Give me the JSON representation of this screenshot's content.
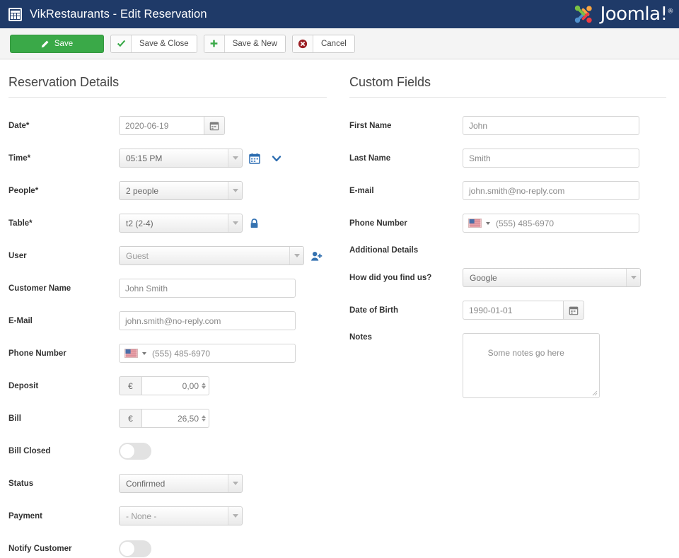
{
  "header": {
    "icon": "calendar-icon",
    "title": "VikRestaurants - Edit Reservation",
    "brand": "Joomla!",
    "brand_sup": "®",
    "bg_color": "#1f3a68"
  },
  "toolbar": {
    "save_label": "Save",
    "save_close_label": "Save & Close",
    "save_new_label": "Save & New",
    "cancel_label": "Cancel",
    "save_color": "#3aa948",
    "cancel_icon_color": "#9b1f24"
  },
  "left": {
    "section_title": "Reservation Details",
    "fields": {
      "date": {
        "label": "Date*",
        "value": "2020-06-19",
        "icon": "calendar-icon"
      },
      "time": {
        "label": "Time*",
        "value": "05:15 PM",
        "icon1": "calendar-icon",
        "icon2": "chevron-down-icon"
      },
      "people": {
        "label": "People*",
        "value": "2 people"
      },
      "table": {
        "label": "Table*",
        "value": "t2 (2-4)",
        "icon": "lock-icon"
      },
      "user": {
        "label": "User",
        "value": "Guest",
        "icon": "add-user-icon"
      },
      "customer_name": {
        "label": "Customer Name",
        "value": "John Smith"
      },
      "email": {
        "label": "E-Mail",
        "value": "john.smith@no-reply.com"
      },
      "phone": {
        "label": "Phone Number",
        "value": "(555) 485-6970",
        "flag": "us-flag-icon"
      },
      "deposit": {
        "label": "Deposit",
        "currency": "€",
        "value": "0,00"
      },
      "bill": {
        "label": "Bill",
        "currency": "€",
        "value": "26,50"
      },
      "bill_closed": {
        "label": "Bill Closed",
        "state": "off"
      },
      "status": {
        "label": "Status",
        "value": "Confirmed"
      },
      "payment": {
        "label": "Payment",
        "value": "- None -"
      },
      "notify_customer": {
        "label": "Notify Customer",
        "state": "off"
      }
    }
  },
  "right": {
    "section_title": "Custom Fields",
    "subhead": "Additional Details",
    "fields": {
      "first_name": {
        "label": "First Name",
        "value": "John"
      },
      "last_name": {
        "label": "Last Name",
        "value": "Smith"
      },
      "email": {
        "label": "E-mail",
        "value": "john.smith@no-reply.com"
      },
      "phone": {
        "label": "Phone Number",
        "value": "(555) 485-6970",
        "flag": "us-flag-icon"
      },
      "find_us": {
        "label": "How did you find us?",
        "value": "Google"
      },
      "dob": {
        "label": "Date of Birth",
        "value": "1990-01-01",
        "icon": "calendar-icon"
      },
      "notes": {
        "label": "Notes",
        "value": "Some notes go here"
      }
    }
  }
}
